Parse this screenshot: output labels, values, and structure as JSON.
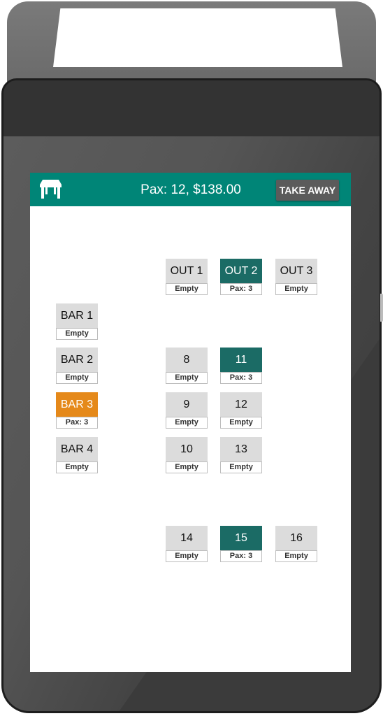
{
  "header": {
    "icon": "table-icon",
    "title": "Pax: 12, $138.00",
    "takeaway_label": "TAKE AWAY"
  },
  "colors": {
    "appbar": "#008577",
    "occupied": "#1b6b65",
    "selected": "#e5891a",
    "empty": "#dcdcdc",
    "takeaway_button": "#5b5b5b"
  },
  "tables": {
    "out1": {
      "name": "OUT 1",
      "status": "Empty",
      "state": "empty"
    },
    "out2": {
      "name": "OUT 2",
      "status": "Pax: 3",
      "state": "occupied"
    },
    "out3": {
      "name": "OUT 3",
      "status": "Empty",
      "state": "empty"
    },
    "bar1": {
      "name": "BAR 1",
      "status": "Empty",
      "state": "empty"
    },
    "bar2": {
      "name": "BAR 2",
      "status": "Empty",
      "state": "empty"
    },
    "bar3": {
      "name": "BAR 3",
      "status": "Pax: 3",
      "state": "selected"
    },
    "bar4": {
      "name": "BAR 4",
      "status": "Empty",
      "state": "empty"
    },
    "t8": {
      "name": "8",
      "status": "Empty",
      "state": "empty"
    },
    "t9": {
      "name": "9",
      "status": "Empty",
      "state": "empty"
    },
    "t10": {
      "name": "10",
      "status": "Empty",
      "state": "empty"
    },
    "t11": {
      "name": "11",
      "status": "Pax: 3",
      "state": "occupied"
    },
    "t12": {
      "name": "12",
      "status": "Empty",
      "state": "empty"
    },
    "t13": {
      "name": "13",
      "status": "Empty",
      "state": "empty"
    },
    "t14": {
      "name": "14",
      "status": "Empty",
      "state": "empty"
    },
    "t15": {
      "name": "15",
      "status": "Pax: 3",
      "state": "occupied"
    },
    "t16": {
      "name": "16",
      "status": "Empty",
      "state": "empty"
    }
  }
}
